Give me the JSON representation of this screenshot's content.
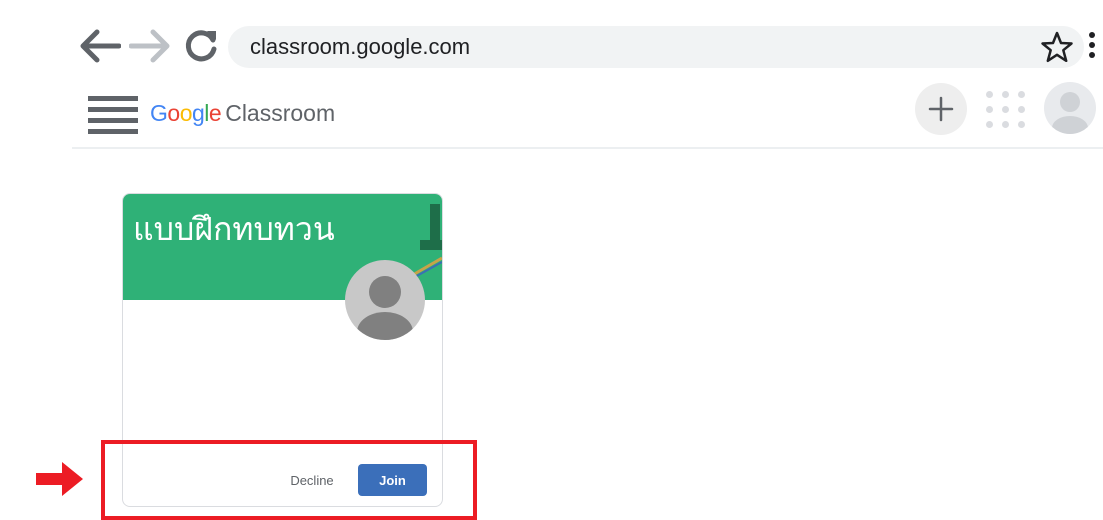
{
  "browser": {
    "url": "classroom.google.com",
    "icons": [
      "back-arrow-icon",
      "forward-arrow-icon",
      "reload-icon",
      "star-icon",
      "menu-dots-icon"
    ]
  },
  "app": {
    "brand_google": "Google",
    "brand_product": "Classroom",
    "icons": [
      "hamburger-menu-icon",
      "plus-icon",
      "apps-grid-icon",
      "account-avatar-icon"
    ]
  },
  "class_card": {
    "title": "แบบฝึกทบทวน",
    "header_color": "#2fb177",
    "decline_label": "Decline",
    "join_label": "Join",
    "join_color": "#3b6fba"
  },
  "annotation": {
    "color": "#ec1c24",
    "icons": [
      "red-arrow-icon"
    ]
  }
}
